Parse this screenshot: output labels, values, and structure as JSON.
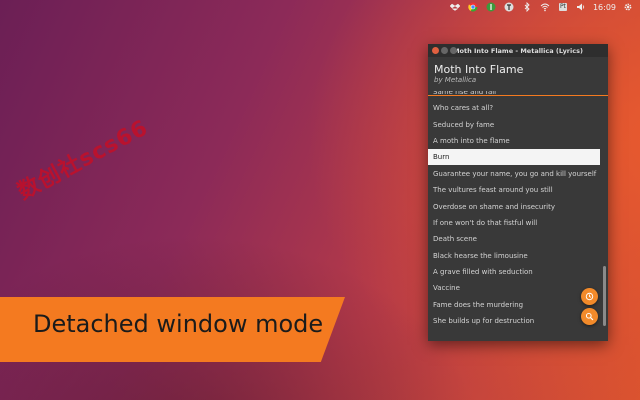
{
  "panel": {
    "clock": "16:09",
    "badge": "Pt",
    "icons": [
      "dropbox-icon",
      "chrome-icon",
      "sync-icon",
      "app-indicator-icon",
      "bluetooth-icon",
      "wifi-icon",
      "keyboard-layout-icon",
      "volume-icon",
      "clock",
      "gear-icon"
    ]
  },
  "watermark": "数创社scs66",
  "banner": {
    "text": "Detached window mode",
    "color": "#f47a20"
  },
  "window": {
    "title": "Moth Into Flame - Metallica (Lyrics)",
    "song_title": "Moth Into Flame",
    "song_artist": "by Metallica",
    "accent": "#f47a20",
    "lyrics": [
      "Same rise and fall",
      "Who cares at all?",
      "Seduced by fame",
      "A moth into the flame",
      "Burn",
      "Guarantee your name, you go and kill yourself",
      "The vultures feast around you still",
      "Overdose on shame and insecurity",
      "If one won't do that fistful will",
      "Death scene",
      "Black hearse the limousine",
      "A grave filled with seduction",
      "Vaccine",
      "Fame does the murdering",
      "She builds up for destruction"
    ],
    "active_line": "Burn",
    "buttons": {
      "history": "history-icon",
      "search": "search-icon"
    }
  }
}
